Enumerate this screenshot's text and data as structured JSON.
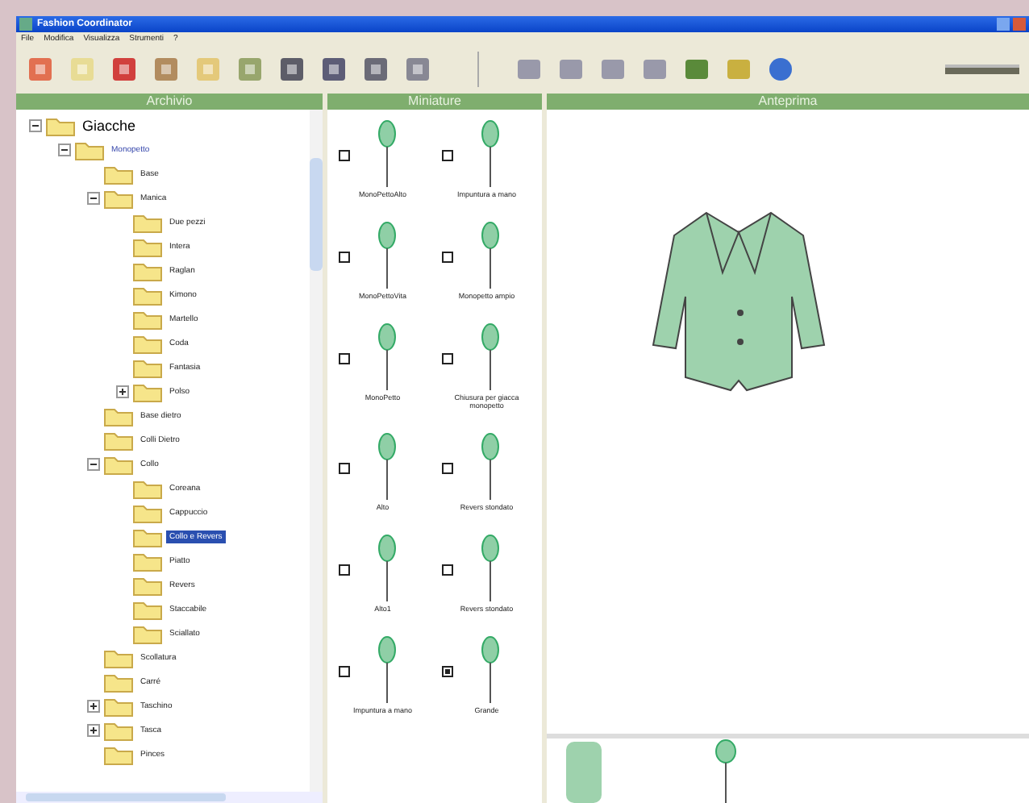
{
  "window": {
    "title": "Fashion Coordinator"
  },
  "menu": [
    "File",
    "Modifica",
    "Visualizza",
    "Strumenti",
    "?"
  ],
  "panels": {
    "archive": "Archivio",
    "thumbnails": "Miniature",
    "preview": "Anteprima"
  },
  "tree": [
    {
      "label": "Giacche",
      "expanded": true,
      "selected": false,
      "children": [
        {
          "label": "Monopetto",
          "expanded": true,
          "selected": false,
          "children": [
            {
              "label": "Base",
              "selected": false
            },
            {
              "label": "Manica",
              "expanded": true,
              "selected": false,
              "children": [
                {
                  "label": "Due pezzi",
                  "selected": false
                },
                {
                  "label": "Intera",
                  "selected": false
                },
                {
                  "label": "Raglan",
                  "selected": false
                },
                {
                  "label": "Kimono",
                  "selected": false
                },
                {
                  "label": "Martello",
                  "selected": false
                },
                {
                  "label": "Coda",
                  "selected": false
                },
                {
                  "label": "Fantasia",
                  "selected": false
                },
                {
                  "label": "Polso",
                  "expanded": false,
                  "selected": false
                }
              ]
            },
            {
              "label": "Base dietro",
              "selected": false
            },
            {
              "label": "Colli Dietro",
              "selected": false
            },
            {
              "label": "Collo",
              "expanded": true,
              "selected": false,
              "children": [
                {
                  "label": "Coreana",
                  "selected": false
                },
                {
                  "label": "Cappuccio",
                  "selected": false
                },
                {
                  "label": "Collo e Revers",
                  "selected": true
                },
                {
                  "label": "Piatto",
                  "selected": false
                },
                {
                  "label": "Revers",
                  "selected": false
                },
                {
                  "label": "Staccabile",
                  "selected": false
                },
                {
                  "label": "Sciallato",
                  "selected": false
                }
              ]
            },
            {
              "label": "Scollatura",
              "selected": false
            },
            {
              "label": "Carré",
              "selected": false
            },
            {
              "label": "Taschino",
              "expanded": false,
              "selected": false
            },
            {
              "label": "Tasca",
              "expanded": false,
              "selected": false
            },
            {
              "label": "Pinces",
              "selected": false
            }
          ]
        }
      ]
    }
  ],
  "thumbnails": [
    {
      "label": "MonoPettoAlto",
      "checked": false
    },
    {
      "label": "Impuntura a mano",
      "checked": false
    },
    {
      "label": "MonoPettoVita",
      "checked": false
    },
    {
      "label": "Monopetto ampio",
      "checked": false
    },
    {
      "label": "MonoPetto",
      "checked": false
    },
    {
      "label": "Chiusura per giacca monopetto",
      "checked": false
    },
    {
      "label": "Alto",
      "checked": false
    },
    {
      "label": "Revers stondato",
      "checked": false
    },
    {
      "label": "Alto1",
      "checked": false
    },
    {
      "label": "Revers stondato",
      "checked": false
    },
    {
      "label": "Impuntura a mano",
      "checked": false
    },
    {
      "label": "Grande",
      "checked": true
    }
  ]
}
